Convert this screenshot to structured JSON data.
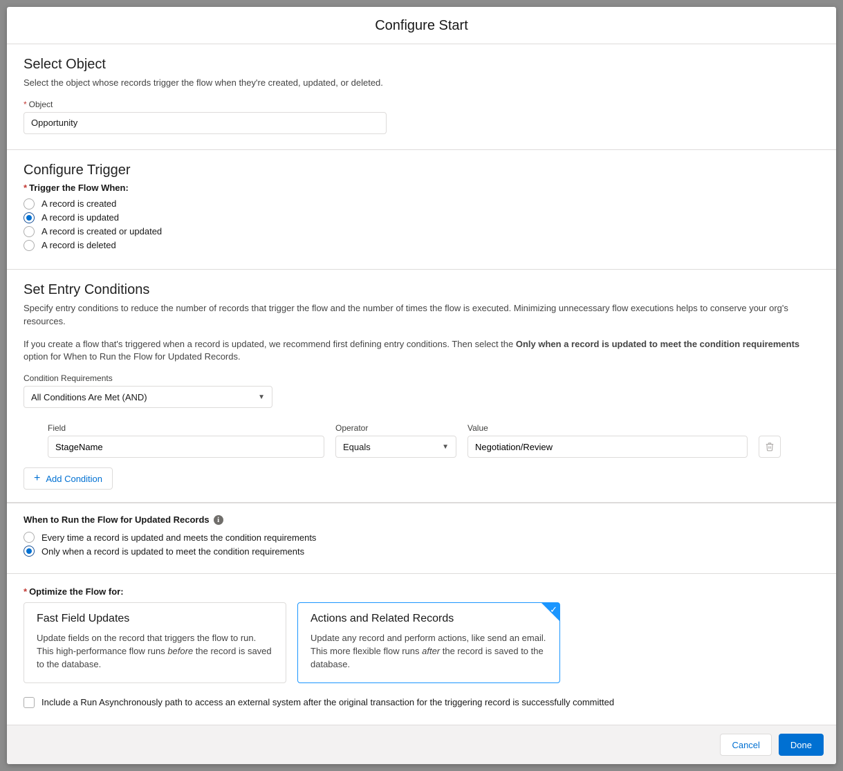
{
  "header": {
    "title": "Configure Start"
  },
  "sections": {
    "selectObject": {
      "title": "Select Object",
      "help": "Select the object whose records trigger the flow when they're created, updated, or deleted.",
      "objectLabel": "Object",
      "objectValue": "Opportunity"
    },
    "configureTrigger": {
      "title": "Configure Trigger",
      "triggerLabel": "Trigger the Flow When:",
      "options": {
        "created": "A record is created",
        "updated": "A record is updated",
        "createdOrUpdated": "A record is created or updated",
        "deleted": "A record is deleted"
      }
    },
    "entryConditions": {
      "title": "Set Entry Conditions",
      "help1": "Specify entry conditions to reduce the number of records that trigger the flow and the number of times the flow is executed. Minimizing unnecessary flow executions helps to conserve your org's resources.",
      "help2a": "If you create a flow that's triggered when a record is updated, we recommend first defining entry conditions. Then select the ",
      "help2b": "Only when a record is updated to meet the condition requirements",
      "help2c": " option for When to Run the Flow for Updated Records.",
      "condReqLabel": "Condition Requirements",
      "condReqValue": "All Conditions Are Met (AND)",
      "columns": {
        "field": "Field",
        "operator": "Operator",
        "value": "Value"
      },
      "row": {
        "field": "StageName",
        "operator": "Equals",
        "value": "Negotiation/Review"
      },
      "addCondition": "Add Condition"
    },
    "whenToRun": {
      "title": "When to Run the Flow for Updated Records",
      "options": {
        "every": "Every time a record is updated and meets the condition requirements",
        "only": "Only when a record is updated to meet the condition requirements"
      }
    },
    "optimize": {
      "title": "Optimize the Flow for:",
      "cards": {
        "fast": {
          "title": "Fast Field Updates",
          "desc1": "Update fields on the record that triggers the flow to run. This high-performance flow runs ",
          "descItalic": "before",
          "desc2": " the record is saved to the database."
        },
        "actions": {
          "title": "Actions and Related Records",
          "desc1": "Update any record and perform actions, like send an email. This more flexible flow runs ",
          "descItalic": "after",
          "desc2": " the record is saved to the database."
        }
      },
      "asyncLabel": "Include a Run Asynchronously path to access an external system after the original transaction for the triggering record is successfully committed"
    }
  },
  "footer": {
    "cancel": "Cancel",
    "done": "Done"
  }
}
